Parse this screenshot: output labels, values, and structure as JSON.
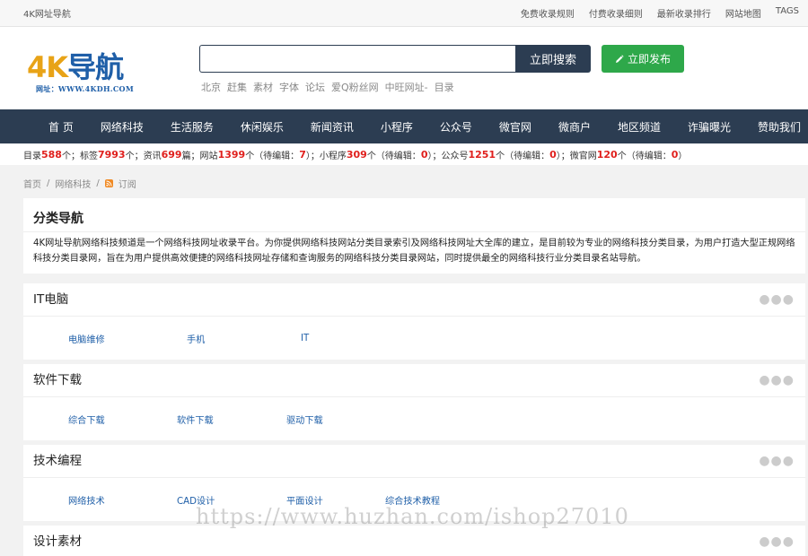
{
  "topbar": {
    "site": "4K网址导航",
    "links": [
      "免费收录规则",
      "付费收录细则",
      "最新收录排行",
      "网站地图",
      "TAGS"
    ]
  },
  "logo": {
    "big_prefix": "4K",
    "big_suffix": "导航",
    "sub": "网址：WWW.4KDH.COM"
  },
  "search": {
    "value": "",
    "button": "立即搜索"
  },
  "publish": {
    "label": "立即发布",
    "icon": "pencil-icon"
  },
  "hotwords": [
    "北京",
    "赶集",
    "素材",
    "字体",
    "论坛",
    "爱Q粉丝网",
    "中旺网址-",
    "目录"
  ],
  "nav": [
    "首 页",
    "网络科技",
    "生活服务",
    "休闲娱乐",
    "新闻资讯",
    "小程序",
    "公众号",
    "微官网",
    "微商户",
    "地区频道",
    "诈骗曝光",
    "赞助我们"
  ],
  "stats": {
    "t1": "目录 ",
    "v1": "588",
    "t2": "个；标签 ",
    "v2": "7993",
    "t3": "个；资讯 ",
    "v3": "699",
    "t4": "篇；网站 ",
    "v4": "1399",
    "t5": "个（待编辑：",
    "v5": "7",
    "t6": "）；小程序 ",
    "v6": "309",
    "t7": "个（待编辑：",
    "v7": "0",
    "t8": "）；公众号 ",
    "v8": "1251",
    "t9": "个（待编辑：",
    "v9": "0",
    "t10": "）；微官网 ",
    "v10": "120",
    "t11": "个（待编辑：",
    "v11": "0",
    "t12": "）"
  },
  "breadcrumb": {
    "home": "首页",
    "sep": "/",
    "current": "网络科技",
    "rss": "订阅"
  },
  "intro": {
    "title": "分类导航",
    "text": "4K网址导航网络科技频道是一个网络科技网址收录平台。为你提供网络科技网站分类目录索引及网络科技网址大全库的建立，是目前较为专业的网络科技分类目录，为用户打造大型正规网络科技分类目录网，旨在为用户提供高效便捷的网络科技网址存储和查询服务的网络科技分类目录网站，同时提供最全的网络科技行业分类目录名站导航。"
  },
  "categories": [
    {
      "title": "IT电脑",
      "items": [
        "电脑维修",
        "手机",
        "IT"
      ]
    },
    {
      "title": "软件下载",
      "items": [
        "综合下载",
        "软件下载",
        "驱动下载"
      ]
    },
    {
      "title": "技术编程",
      "items": [
        "网络技术",
        "CAD设计",
        "平面设计",
        "综合技术教程"
      ]
    },
    {
      "title": "设计素材",
      "items": []
    }
  ],
  "watermark": "https://www.huzhan.com/ishop27010"
}
